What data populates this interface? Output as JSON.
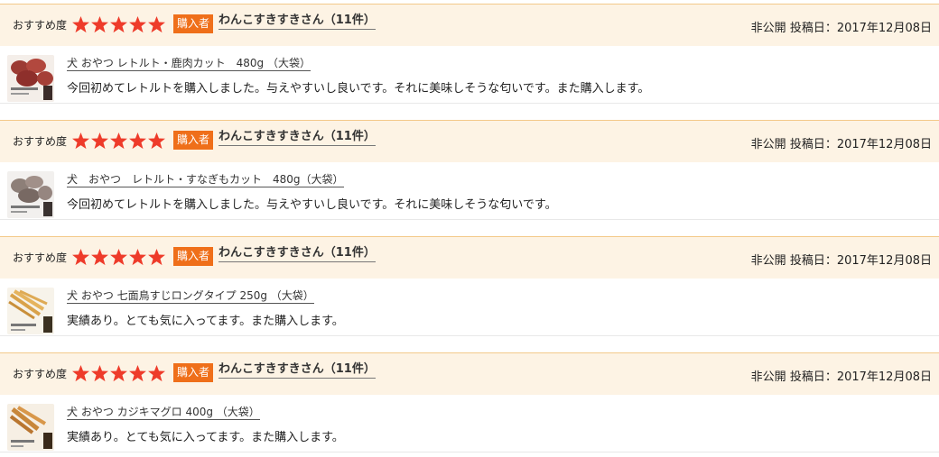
{
  "colors": {
    "star": "#ee3b2a",
    "badge": "#ef6f1a",
    "header_bg": "#fdf3e4",
    "header_border": "#f3c98a"
  },
  "reviews": [
    {
      "rating_label": "おすすめ度",
      "stars": 5,
      "badge": "購入者",
      "reviewer": "わんこすきすきさん（11件）",
      "visibility": "非公開",
      "posted": "投稿日：2017年12月08日",
      "product": "犬 おやつ レトルト・鹿肉カット　480g （大袋）",
      "thumb_icon": "venison-jerky-thumbnail",
      "comment": "今回初めてレトルトを購入しました。与えやすいし良いです。それに美味しそうな匂いです。また購入します。"
    },
    {
      "rating_label": "おすすめ度",
      "stars": 5,
      "badge": "購入者",
      "reviewer": "わんこすきすきさん（11件）",
      "visibility": "非公開",
      "posted": "投稿日：2017年12月08日",
      "product": "犬　おやつ　レトルト・すなぎもカット　480g（大袋）",
      "thumb_icon": "gizzard-thumbnail",
      "comment": "今回初めてレトルトを購入しました。与えやすいし良いです。それに美味しそうな匂いです。"
    },
    {
      "rating_label": "おすすめ度",
      "stars": 5,
      "badge": "購入者",
      "reviewer": "わんこすきすきさん（11件）",
      "visibility": "非公開",
      "posted": "投稿日：2017年12月08日",
      "product": "犬 おやつ 七面鳥すじロングタイプ 250g （大袋）",
      "thumb_icon": "turkey-tendon-thumbnail",
      "comment": "実績あり。とても気に入ってます。また購入します。"
    },
    {
      "rating_label": "おすすめ度",
      "stars": 5,
      "badge": "購入者",
      "reviewer": "わんこすきすきさん（11件）",
      "visibility": "非公開",
      "posted": "投稿日：2017年12月08日",
      "product": "犬 おやつ カジキマグロ 400g （大袋）",
      "thumb_icon": "swordfish-thumbnail",
      "comment": "実績あり。とても気に入ってます。また購入します。"
    }
  ]
}
